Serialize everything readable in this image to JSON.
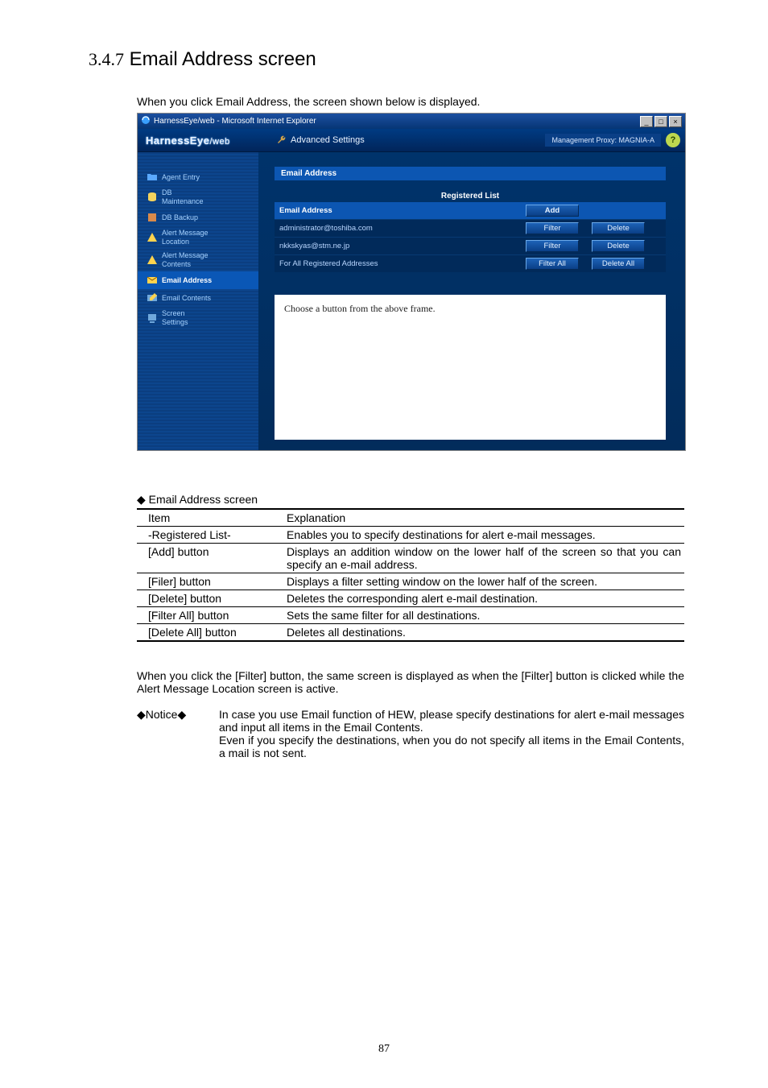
{
  "section_number": "3.4.7",
  "section_title": "Email Address screen",
  "intro_text": "When you click Email Address, the screen shown below is displayed.",
  "screenshot": {
    "titlebar": "HarnessEye/web - Microsoft Internet Explorer",
    "win_min": "_",
    "win_max": "□",
    "win_close": "×",
    "brand_main": "HarnessEye",
    "brand_sub": "/web",
    "adv_settings": "Advanced Settings",
    "mgmt_proxy": "Management Proxy: MAGNIA-A",
    "help": "?",
    "sidebar": [
      "Agent Entry",
      "DB\nMaintenance",
      "DB Backup",
      "Alert Message\nLocation",
      "Alert Message\nContents",
      "Email Address",
      "Email Contents",
      "Screen\nSettings"
    ],
    "panel_title": "Email Address",
    "reg_list_title": "Registered List",
    "col_header": "Email Address",
    "add_btn": "Add",
    "rows": [
      {
        "email": "administrator@toshiba.com",
        "filter": "Filter",
        "delete": "Delete"
      },
      {
        "email": "nkkskyas@stm.ne.jp",
        "filter": "Filter",
        "delete": "Delete"
      }
    ],
    "footer_row": {
      "label": "For All Registered Addresses",
      "filter_all": "Filter All",
      "delete_all": "Delete All"
    },
    "lower_frame_text": "Choose a button from the above frame."
  },
  "caption": "◆ Email Address screen",
  "table": {
    "head_item": "Item",
    "head_exp": "Explanation",
    "rows": [
      {
        "item": "-Registered List-",
        "exp": "Enables you to specify destinations for alert e-mail messages."
      },
      {
        "item": "[Add] button",
        "exp": "Displays an addition window on the lower half of the screen so that you can specify an e-mail address."
      },
      {
        "item": "[Filer] button",
        "exp": "Displays a filter setting window on the lower half of the screen."
      },
      {
        "item": "[Delete] button",
        "exp": "Deletes the corresponding alert e-mail destination."
      },
      {
        "item": "[Filter All] button",
        "exp": "Sets the same filter for all destinations."
      },
      {
        "item": "[Delete All] button",
        "exp": "Deletes all destinations."
      }
    ]
  },
  "after_para": "When you click the [Filter] button, the same screen is displayed as when the [Filter] button is clicked while the Alert Message Location screen is active.",
  "notice_label": "◆Notice◆",
  "notice_body": "In case you use Email function of HEW, please specify destinations for alert e-mail messages and input all items in the Email Contents.\nEven if you specify the destinations, when you do not specify all items in the Email Contents, a mail is not sent.",
  "page_number": "87"
}
